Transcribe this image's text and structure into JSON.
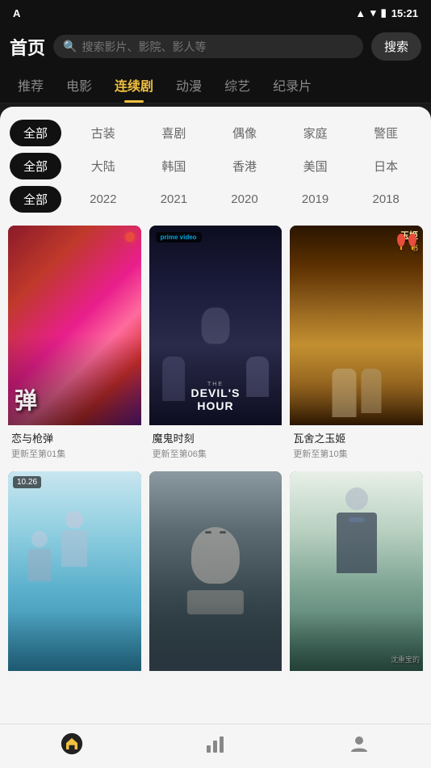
{
  "statusBar": {
    "appIcon": "A",
    "time": "15:21",
    "batteryIcon": "🔋"
  },
  "header": {
    "title": "首页",
    "searchPlaceholder": "搜索影片、影院、影人等",
    "searchButtonLabel": "搜索"
  },
  "navTabs": {
    "items": [
      {
        "id": "recommend",
        "label": "推荐",
        "active": false
      },
      {
        "id": "movie",
        "label": "电影",
        "active": false
      },
      {
        "id": "series",
        "label": "连续剧",
        "active": true
      },
      {
        "id": "anime",
        "label": "动漫",
        "active": false
      },
      {
        "id": "variety",
        "label": "综艺",
        "active": false
      },
      {
        "id": "documentary",
        "label": "纪录片",
        "active": false
      }
    ]
  },
  "filters": {
    "row1": {
      "allLabel": "全部",
      "items": [
        "古装",
        "喜剧",
        "偶像",
        "家庭",
        "警匪"
      ]
    },
    "row2": {
      "allLabel": "全部",
      "items": [
        "大陆",
        "韩国",
        "香港",
        "美国",
        "日本"
      ]
    },
    "row3": {
      "allLabel": "全部",
      "items": [
        "2022",
        "2021",
        "2020",
        "2019",
        "2018"
      ]
    }
  },
  "movies": [
    {
      "id": "1",
      "title": "恋与枪弹",
      "subtitle": "更新至第01集",
      "posterType": "poster-1",
      "badge": ""
    },
    {
      "id": "2",
      "title": "魔鬼时刻",
      "subtitle": "更新至第06集",
      "posterType": "poster-2",
      "badge": "prime video"
    },
    {
      "id": "3",
      "title": "瓦舍之玉姬",
      "subtitle": "更新至第10集",
      "posterType": "poster-3",
      "badge": ""
    },
    {
      "id": "4",
      "title": "",
      "subtitle": "",
      "posterType": "poster-4",
      "badge": "10.26"
    },
    {
      "id": "5",
      "title": "",
      "subtitle": "",
      "posterType": "poster-5",
      "badge": ""
    },
    {
      "id": "6",
      "title": "",
      "subtitle": "",
      "posterType": "poster-6",
      "badge": ""
    }
  ],
  "bottomNav": {
    "items": [
      {
        "id": "home",
        "icon": "home",
        "active": true
      },
      {
        "id": "chart",
        "icon": "bar-chart",
        "active": false
      },
      {
        "id": "profile",
        "icon": "user",
        "active": false
      }
    ]
  }
}
